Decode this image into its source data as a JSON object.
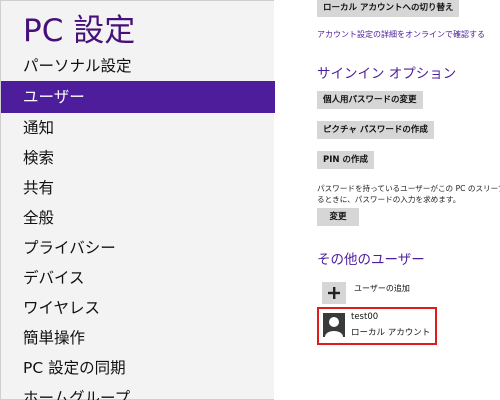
{
  "window": {
    "title": "PC 設定"
  },
  "nav": {
    "items": [
      {
        "label": "パーソナル設定",
        "selected": false
      },
      {
        "label": "ユーザー",
        "selected": true
      },
      {
        "label": "通知",
        "selected": false
      },
      {
        "label": "検索",
        "selected": false
      },
      {
        "label": "共有",
        "selected": false
      },
      {
        "label": "全般",
        "selected": false
      },
      {
        "label": "プライバシー",
        "selected": false
      },
      {
        "label": "デバイス",
        "selected": false
      },
      {
        "label": "ワイヤレス",
        "selected": false
      },
      {
        "label": "簡単操作",
        "selected": false
      },
      {
        "label": "PC 設定の同期",
        "selected": false
      },
      {
        "label": "ホームグループ",
        "selected": false
      }
    ]
  },
  "account": {
    "switch_local_button": "ローカル アカウントへの切り替え",
    "details_link": "アカウント設定の詳細をオンラインで確認する"
  },
  "signin_options": {
    "heading": "サインイン オプション",
    "change_password_button": "個人用パスワードの変更",
    "picture_password_button": "ピクチャ パスワードの作成",
    "pin_button": "PIN の作成",
    "wake_description": "パスワードを持っているユーザーがこの PC のスリープを解除するときに、パスワードの入力を求めます。",
    "change_button": "変更"
  },
  "other_users": {
    "heading": "その他のユーザー",
    "add_user_label": "ユーザーの追加",
    "users": [
      {
        "name": "test00",
        "type": "ローカル アカウント"
      }
    ]
  },
  "colors": {
    "accent": "#4d1d9c",
    "nav_background": "#f3f3f3",
    "button_background": "#d6d6d6",
    "highlight_border": "#e01b1b"
  },
  "icons": {
    "add_user": "plus-icon",
    "user_avatar": "person-silhouette-icon"
  }
}
